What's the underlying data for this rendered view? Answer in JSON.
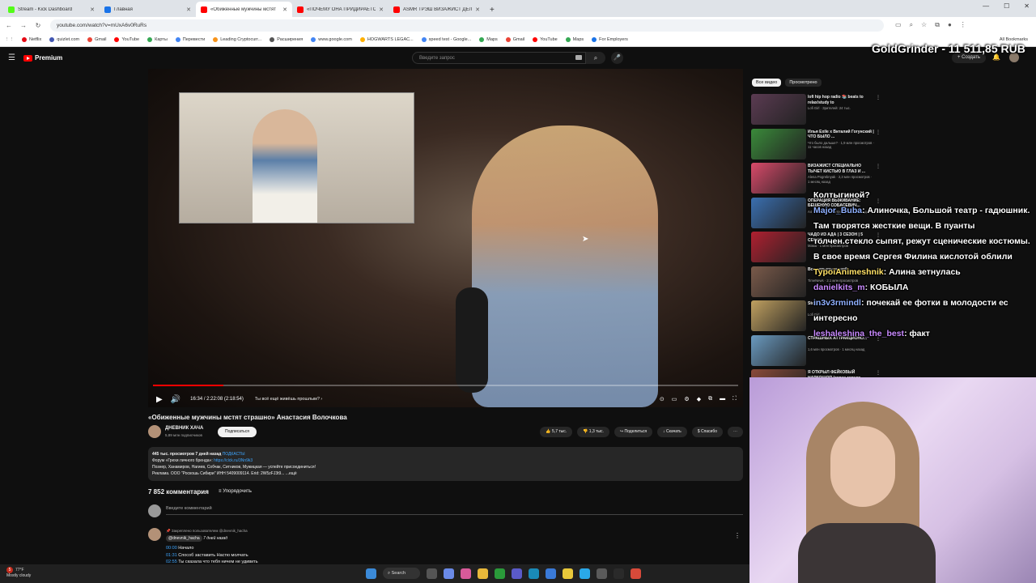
{
  "browser": {
    "tabs": [
      {
        "title": "Stream - Kick Dashboard",
        "color": "#53fc18"
      },
      {
        "title": "Главная",
        "color": "#1a73e8"
      },
      {
        "title": "«Обиженные мужчины мстят",
        "color": "#ff0000"
      },
      {
        "title": "«ПОЧЕМУ ОНА ПРИДИРАЕТС",
        "color": "#ff0000"
      },
      {
        "title": "ASMR ТРЭШ ВИЗАЖИСТ ДЕЛ",
        "color": "#ff0000"
      }
    ],
    "new_tab": "+",
    "url": "youtube.com/watch?v=mUxA6v0RuRs",
    "bookmarks": [
      "Netflix",
      "quizlet.com",
      "Gmail",
      "YouTube",
      "Карты",
      "Перевести",
      "Leading Cryptocurr...",
      "Расширения",
      "www.google.com",
      "HOGWARTS LEGAC...",
      "speed test - Google...",
      "Maps",
      "Gmail",
      "YouTube",
      "Maps",
      "For Employers"
    ],
    "all_bookmarks": "All Bookmarks"
  },
  "youtube": {
    "logo": "Premium",
    "search_placeholder": "Введите запрос",
    "create": "+ Создать",
    "video": {
      "title": "«Обиженные мужчины мстят страшно» Анастасия Волочкова",
      "time": "16:34 / 2:22:08 (2:18:54)",
      "chapter": "Ты всё ещё живёшь прошлым? ›",
      "progress": 0.12,
      "channel": "ДНЕВНИК ХАЧА",
      "subs": "5,89 млн подписчиков",
      "subscribe": "Подписаться",
      "likes": "5,7 тыс.",
      "dislikes": "1,3 тыс.",
      "share": "Поделиться",
      "download": "Скачать",
      "thanks": "Спасибо"
    },
    "description": {
      "line1": "445 тыс. просмотров  7 дней назад",
      "tag": "ПОДКАСТЫ",
      "line2": "Форум «Грехи личного бренда»:",
      "link": "https://clck.ru/3Nn9k3",
      "line3": "Познер, Ханамиров, Нагиев, Собчак, Ситников, Мужицкая — успейте присоединиться!",
      "line4": "Реклама. ООО \"Роскошь Сибири\" ИНН 5409009114. Erid: 2W5zFJ3t9... ...ещё"
    },
    "comments": {
      "count": "7 852 комментария",
      "sort": "Упорядочить",
      "input_placeholder": "Введите комментарий",
      "pinned": "Закреплено пользователем @dnevnik_hacha",
      "author": "@dnevnik_hacha",
      "author_time": "7 дней назад",
      "lines": [
        {
          "ts": "00:00",
          "text": "Начало"
        },
        {
          "ts": "01:31",
          "text": "Способ заставить Настю молчать"
        },
        {
          "ts": "02:55",
          "text": "Ты сказала что тебя ничем не удивить"
        }
      ]
    },
    "chips": [
      "Все видео",
      "Просмотрено"
    ],
    "recommendations": [
      {
        "title": "lofi hip hop radio 📚 beats to relax/study to",
        "meta": "Lofi Girl · Зрителей: 24 тыс.",
        "color": "#5b3b52"
      },
      {
        "title": "Илья Exile х Виталий Гогунский | ЧТО БЫЛО ...",
        "meta": "Что было дальше? · 1,9 млн просмотров · 11 часов назад",
        "color": "#3a8a3a"
      },
      {
        "title": "ВИЗАЖИСТ СПЕЦИАЛЬНО ТЫЧЕТ КИСТЬЮ В ГЛАЗ И ...",
        "meta": "Alena Pogrebnyak · 2,3 млн просмотров · 1 месяц назад",
        "color": "#d94a6a"
      },
      {
        "title": "ОПЕРАЦИЯ ВЫЖИВАНИЕ: БЕШЕНУЮ СОБАСЕВИЧ...",
        "meta": "A4 · 1 млн просмотров · 1 день назад",
        "color": "#3a6fb0"
      },
      {
        "title": "ЧАДО ИЗ АДА | 3 СЕЗОН | 5 СЕРИЯ",
        "meta": "Мама · 1 млн просмотров",
        "color": "#b02030"
      },
      {
        "title": "Все серьезы вашей ...",
        "meta": "TimeNews · 2,1 млн просмотров",
        "color": "#7a5a4a"
      },
      {
        "title": "Stop ...",
        "meta": "Lofi Girl",
        "color": "#c0a060"
      },
      {
        "title": "СТРАШНЫХ АТТРАКЦИОНО...",
        "meta": "1,6 млн просмотров · 1 месяц назад",
        "color": "#6a9ac0"
      },
      {
        "title": "Я ОТКРЫЛ ФЕЙКОВЫЙ НАРКОШОП (сквиз торчко...",
        "meta": "",
        "color": "#8a4a3a"
      }
    ]
  },
  "stream_overlay": {
    "goal": "GoldGrinder - 11 511,85 RUB",
    "chat": [
      {
        "user": "",
        "text": "Колтыгиной?"
      },
      {
        "user": "Major_Buba",
        "text": "Алиночка, Большой театр - гадюшник. Там творятся жесткие вещи. В пуанты толчен.стекло сыпят, режут сценические костюмы. В свое время Сергея Филина кислотой облили"
      },
      {
        "user": "TypoiAnimeshnik",
        "text": "Алина зетнулась"
      },
      {
        "user": "danielkits_m",
        "text": "КОБЫЛА"
      },
      {
        "user": "in3v3rmindl",
        "text": "почекай ее фотки в молодости ес интересно"
      },
      {
        "user": "leshaleshina_the_best",
        "text": "факт"
      }
    ]
  },
  "taskbar": {
    "weather_badge": "5",
    "temp": "77°F",
    "condition": "Mostly cloudy",
    "search": "Search"
  }
}
